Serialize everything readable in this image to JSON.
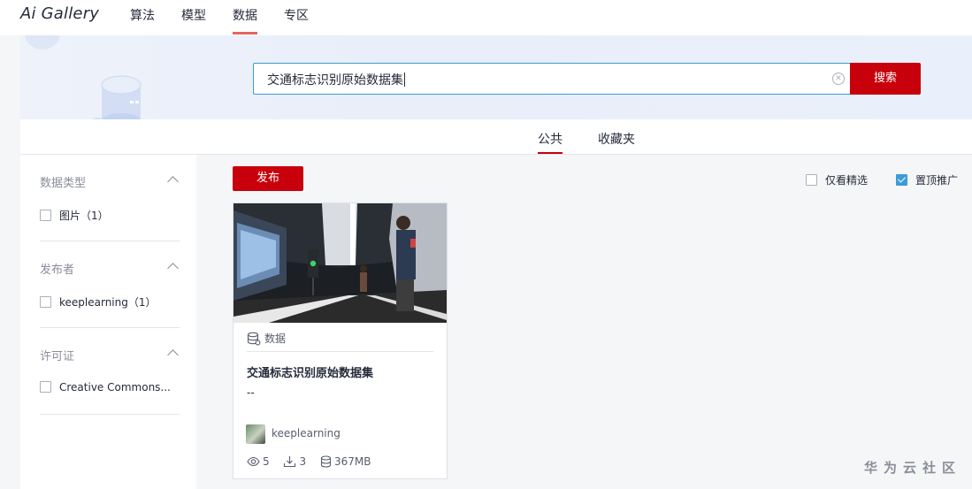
{
  "brand": {
    "logo": "Ai Gallery"
  },
  "nav": {
    "items": [
      {
        "label": "算法"
      },
      {
        "label": "模型"
      },
      {
        "label": "数据"
      },
      {
        "label": "专区"
      }
    ],
    "active_index": 2
  },
  "search": {
    "value": "交通标志识别原始数据集",
    "button_label": "搜索"
  },
  "tabs": {
    "items": [
      {
        "label": "公共"
      },
      {
        "label": "收藏夹"
      }
    ],
    "active_index": 0
  },
  "filters": [
    {
      "title": "数据类型",
      "options": [
        {
          "label": "图片（1）"
        }
      ]
    },
    {
      "title": "发布者",
      "options": [
        {
          "label": "keeplearning（1）"
        }
      ]
    },
    {
      "title": "许可证",
      "options": [
        {
          "label": "Creative Commons..."
        }
      ]
    }
  ],
  "toolbar": {
    "publish_label": "发布",
    "only_featured_label": "仅看精选",
    "only_featured_checked": false,
    "pin_promo_label": "置顶推广",
    "pin_promo_checked": true
  },
  "cards": [
    {
      "type_label": "数据",
      "title": "交通标志识别原始数据集",
      "description": "--",
      "author": "keeplearning",
      "views": "5",
      "downloads": "3",
      "size": "367MB"
    }
  ],
  "watermark": "华为云社区",
  "icons": {
    "clear": "clear-circle-icon",
    "database": "database-icon",
    "view": "eye-icon",
    "download": "download-icon"
  },
  "colors": {
    "primary": "#c7000b",
    "accent_blue": "#3c9bd9",
    "nav_underline": "#e8635f"
  }
}
